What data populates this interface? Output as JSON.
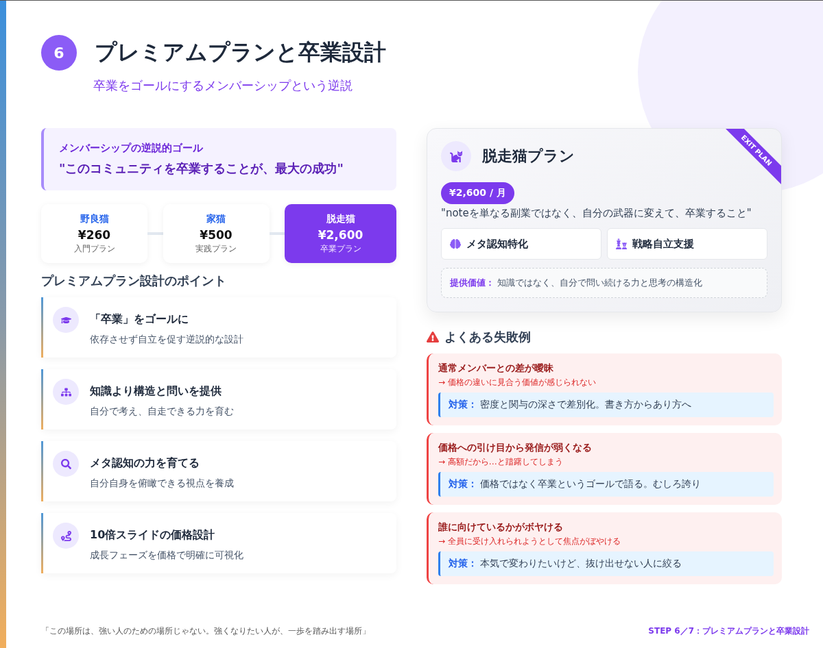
{
  "step_number": "6",
  "title": "プレミアムプランと卒業設計",
  "subtitle": "卒業をゴールにするメンバーシップという逆説",
  "goal_box": {
    "label": "メンバーシップの逆説的ゴール",
    "quote": "\"このコミュニティを卒業することが、最大の成功\""
  },
  "plans": [
    {
      "name": "野良猫",
      "price": "¥260",
      "caption": "入門プラン",
      "selected": false
    },
    {
      "name": "家猫",
      "price": "¥500",
      "caption": "実践プラン",
      "selected": false
    },
    {
      "name": "脱走猫",
      "price": "¥2,600",
      "caption": "卒業プラン",
      "selected": true
    }
  ],
  "points_heading": "プレミアムプラン設計のポイント",
  "points": [
    {
      "title": "「卒業」をゴールに",
      "description": "依存させず自立を促す逆説的な設計"
    },
    {
      "title": "知識より構造と問いを提供",
      "description": "自分で考え、自走できる力を育む"
    },
    {
      "title": "メタ認知の力を育てる",
      "description": "自分自身を俯瞰できる視点を養成"
    },
    {
      "title": "10倍スライドの価格設計",
      "description": "成長フェーズを価格で明確に可視化"
    }
  ],
  "featured_plan": {
    "ribbon": "EXIT PLAN",
    "name": "脱走猫プラン",
    "price": "¥2,600 / 月",
    "tagline": "\"noteを単なる副業ではなく、自分の武器に変えて、卒業すること\"",
    "features": [
      "メタ認知特化",
      "戦略自立支援"
    ],
    "value_label": "提供価値：",
    "value_text": "知識ではなく、自分で問い続ける力と思考の構造化"
  },
  "failures_heading": "よくある失敗例",
  "failures": [
    {
      "title": "通常メンバーとの差が曖昧",
      "consequence": "→ 価格の違いに見合う価値が感じられない",
      "fix_label": "対策：",
      "fix_text": "密度と関与の深さで差別化。書き方からあり方へ"
    },
    {
      "title": "価格への引け目から発信が弱くなる",
      "consequence": "→ 高額だから…と躊躇してしまう",
      "fix_label": "対策：",
      "fix_text": "価格ではなく卒業というゴールで語る。むしろ誇り"
    },
    {
      "title": "誰に向けているかがボヤける",
      "consequence": "→ 全員に受け入れられようとして焦点がぼやける",
      "fix_label": "対策：",
      "fix_text": "本気で変わりたいけど、抜け出せない人に絞る"
    }
  ],
  "footer": {
    "quote": "「この場所は、強い人のための場所じゃない。強くなりたい人が、一歩を踏み出す場所」",
    "step": "STEP 6／7：プレミアムプランと卒業設計"
  }
}
